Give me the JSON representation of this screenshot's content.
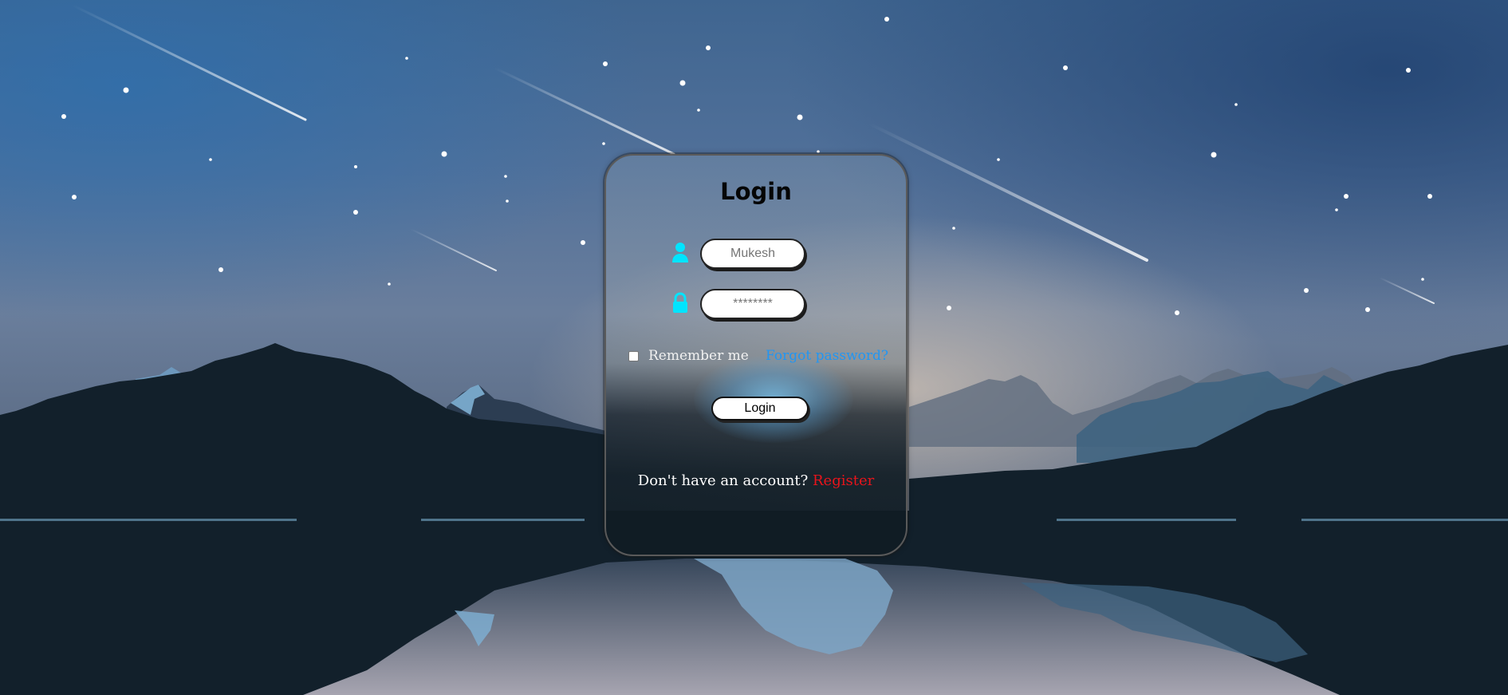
{
  "colors": {
    "accent_icon": "#00e5ff",
    "forgot_link": "#2196f3",
    "register_link": "#e8141b"
  },
  "login_card": {
    "title": "Login",
    "username": {
      "icon": "user-icon",
      "placeholder": "Mukesh",
      "value": ""
    },
    "password": {
      "icon": "lock-icon",
      "placeholder": "********",
      "value": ""
    },
    "remember_label": "Remember me",
    "remember_checked": false,
    "forgot_label": "Forgot password?",
    "login_button_label": "Login",
    "register_prompt": "Don't have an account?",
    "register_label": "Register"
  }
}
